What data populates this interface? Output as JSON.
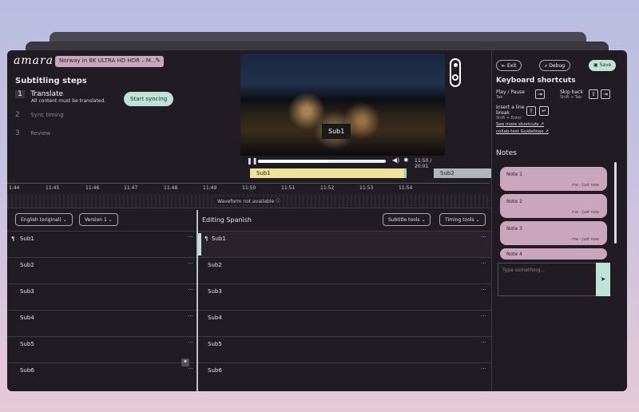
{
  "header": {
    "logo": "amara",
    "video_title": "Norway in 8K ULTRA HD HDR – M...",
    "edit_glyph": "✎",
    "exit_label": "Exit",
    "debug_label": "Debug",
    "save_label": "Save"
  },
  "steps": {
    "title": "Subtitling steps",
    "items": [
      {
        "num": "1",
        "label": "Translate",
        "sub": "All content must be translated."
      },
      {
        "num": "2",
        "label": "Sync timing"
      },
      {
        "num": "3",
        "label": "Review"
      }
    ],
    "sync_button": "Start syncing"
  },
  "video": {
    "caption": "Sub1",
    "time": "11:50 / 20:01",
    "progress": 0.55
  },
  "timeline": {
    "subs": [
      "Sub1",
      "Sub2"
    ],
    "ticks": [
      "1:44",
      "11:45",
      "11:46",
      "11:47",
      "11:48",
      "11:49",
      "11:50",
      "11:51",
      "11:52",
      "11:53",
      "11:54"
    ],
    "waveform_text": "Waveform not available"
  },
  "editor": {
    "language": "English (original)",
    "version": "Version 1",
    "title": "Editing Spanish",
    "subtitle_tools": "Subtitle tools",
    "timing_tools": "Timing tools",
    "left_rows": [
      "Sub1",
      "Sub2",
      "Sub3",
      "Sub4",
      "Sub5",
      "Sub6"
    ],
    "right_rows": [
      "Sub1",
      "Sub2",
      "Sub3",
      "Sub4",
      "Sub5",
      "Sub6"
    ]
  },
  "shortcuts": {
    "title": "Keyboard shortcuts",
    "play_pause": "Play / Pause",
    "play_pause_key": "Tab",
    "skip_back": "Skip back",
    "skip_back_key": "Shift + Tab",
    "line_break": "Insert a line break",
    "line_break_key": "Shift + Enter",
    "more_link": "See more shortcuts",
    "guidelines_link": "collab-test Guidelines"
  },
  "notes": {
    "title": "Notes",
    "items": [
      {
        "label": "Note 1",
        "meta": "me - Just now"
      },
      {
        "label": "Note 2",
        "meta": "me - Just now"
      },
      {
        "label": "Note 3",
        "meta": "me - Just now"
      },
      {
        "label": "Note 4",
        "meta": ""
      }
    ],
    "placeholder": "Type something..."
  }
}
